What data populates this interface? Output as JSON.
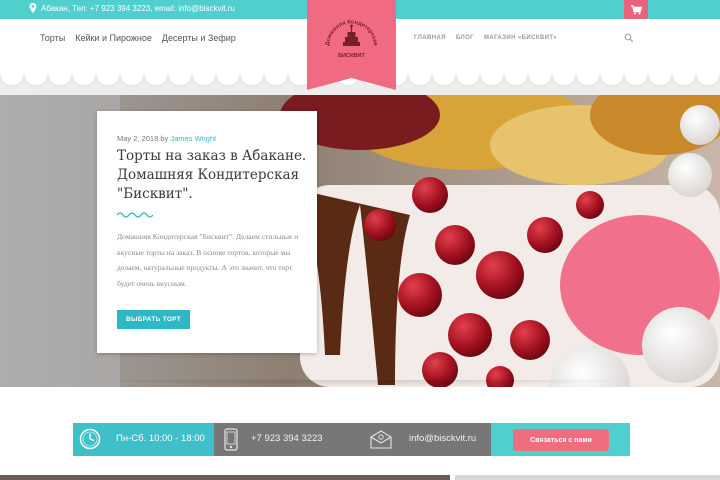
{
  "topbar": {
    "contact_text": "Абакан, Тел: +7 923 394 3223, email: info@bisckvit.ru"
  },
  "nav_left": [
    "Торты",
    "Кейки и Пирожное",
    "Десерты и Зефир"
  ],
  "nav_right": [
    "ГЛАВНАЯ",
    "БЛОГ",
    "МАГАЗИН «БИСКВИТ»"
  ],
  "logo": {
    "arc_text": "Домашняя Кондитерская",
    "name": "БИСКВИТ"
  },
  "post": {
    "date": "May 2, 2018",
    "by": "by",
    "author": "James Wright",
    "title": "Торты на заказ в Абакане. Домашняя Кондитерская \"Бисквит\".",
    "excerpt": "Домашняя Кондитерская \"Бисквит\". Делаем стильные и вкусные торты на заказ. В основе тортов, которые мы делаем, натуральные продукты. А это значит, что торт будет очень вкусным.",
    "button_label": "ВЫБРАТЬ ТОРТ"
  },
  "infobar": {
    "hours": "Пн-Сб. 10:00 - 18:00",
    "phone": "+7 923 394 3223",
    "email": "info@bisckvit.ru",
    "cta": "Связаться с нами"
  },
  "colors": {
    "accent_teal": "#4fd0cf",
    "accent_pink": "#f06b82",
    "button_teal": "#2db8c4"
  },
  "icons": [
    "location-pin-icon",
    "cart-icon",
    "search-icon",
    "clock-icon",
    "phone-icon",
    "mail-icon"
  ]
}
